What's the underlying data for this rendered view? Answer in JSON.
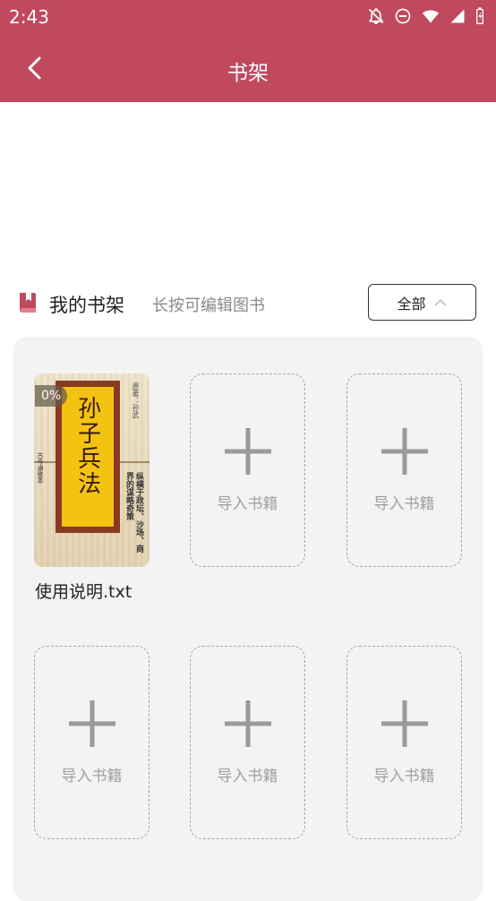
{
  "status_bar": {
    "time": "2:43",
    "icons": [
      "notifications-off-icon",
      "do-not-disturb-icon",
      "wifi-icon",
      "signal-icon",
      "battery-icon"
    ]
  },
  "app_bar": {
    "title": "书架",
    "back_icon": "back-arrow-icon",
    "color": "#c0495e"
  },
  "shelf_header": {
    "title": "我的书架",
    "hint": "长按可编辑图书",
    "filter_label": "全部",
    "icon": "book-icon"
  },
  "books": [
    {
      "name": "使用说明.txt",
      "progress": "0%",
      "cover_title": "孙子兵法",
      "cover_author": "原著：孙武",
      "cover_subtitle": "古今通鉴本",
      "cover_blurb": "纵横于政坛、沙场、商界的谋略奇策"
    }
  ],
  "add_slots": [
    {
      "label": "导入书籍"
    },
    {
      "label": "导入书籍"
    },
    {
      "label": "导入书籍"
    },
    {
      "label": "导入书籍"
    },
    {
      "label": "导入书籍"
    }
  ]
}
